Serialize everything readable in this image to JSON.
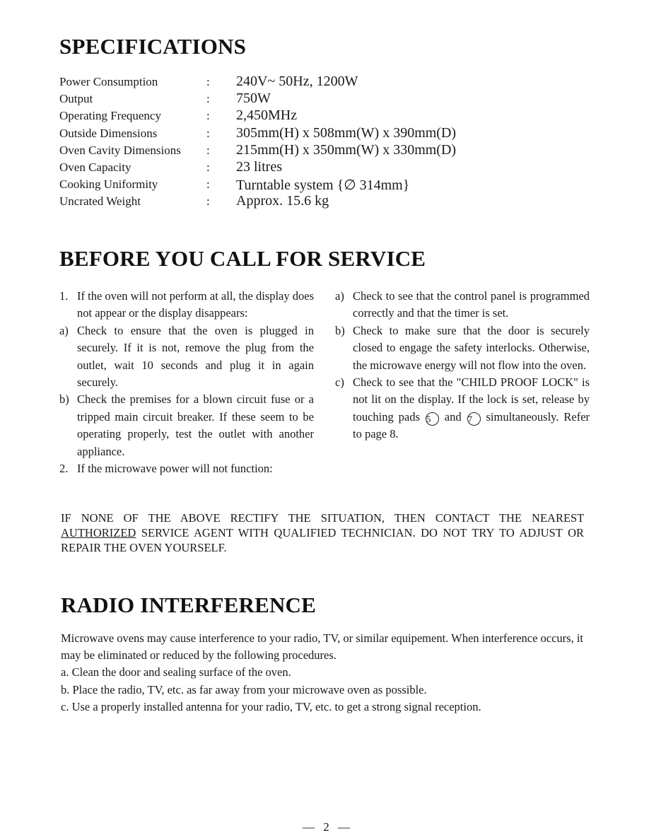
{
  "specifications": {
    "title": "SPECIFICATIONS",
    "rows": [
      {
        "label": "Power Consumption",
        "sep": ":",
        "value": "240V~ 50Hz, 1200W"
      },
      {
        "label": "Output",
        "sep": ":",
        "value": "750W"
      },
      {
        "label": "Operating Frequency",
        "sep": ":",
        "value": "2,450MHz"
      },
      {
        "label": "Outside Dimensions",
        "sep": ":",
        "value": "305mm(H) x 508mm(W) x 390mm(D)"
      },
      {
        "label": "Oven Cavity Dimensions",
        "sep": ":",
        "value": "215mm(H) x 350mm(W) x 330mm(D)"
      },
      {
        "label": "Oven Capacity",
        "sep": ":",
        "value": "23 litres"
      },
      {
        "label": "Cooking Uniformity",
        "sep": ":",
        "value": "Turntable system {∅ 314mm}"
      },
      {
        "label": "Uncrated Weight",
        "sep": ":",
        "value": "Approx. 15.6 kg"
      }
    ]
  },
  "service": {
    "title": "BEFORE YOU CALL FOR SERVICE",
    "left": [
      {
        "marker": "1.",
        "text": "If the oven will not perform at all, the display does not appear or the display disappears:"
      },
      {
        "marker": "a)",
        "text": "Check to ensure that the oven is plugged in securely. If it is not, remove the plug from the outlet, wait 10 seconds and plug it in again securely."
      },
      {
        "marker": "b)",
        "text": "Check the premises for a blown circuit fuse or a tripped main circuit breaker. If these seem to be operating properly, test the outlet with another appliance."
      },
      {
        "marker": "2.",
        "text": "If the microwave power will not function:"
      }
    ],
    "right": [
      {
        "marker": "a)",
        "text": "Check to see that the control panel is programmed correctly and that the timer is set."
      },
      {
        "marker": "b)",
        "text": "Check to make sure that the door is securely closed to engage the safety interlocks. Otherwise, the microwave energy will not flow into the oven."
      },
      {
        "marker": "c)",
        "text_before": "Check to see that the \"CHILD PROOF LOCK\" is not lit on the display. If the lock is set, release by touching pads",
        "pad1": "5",
        "text_mid": "and",
        "pad2": "7",
        "text_after": "simultaneously. Refer to page 8."
      }
    ],
    "notice": {
      "before": "IF NONE OF THE ABOVE RECTIFY THE SITUATION, THEN CONTACT THE NEAREST",
      "underlined": "AUTHORIZED",
      "after": "SERVICE AGENT WITH QUALIFIED TECHNICIAN. DO NOT TRY TO ADJUST OR REPAIR THE OVEN YOURSELF."
    }
  },
  "radio": {
    "title": "RADIO INTERFERENCE",
    "intro": "Microwave ovens may cause interference to your radio, TV, or similar equipement. When interference occurs, it may be eliminated or reduced by the following procedures.",
    "steps": [
      "a. Clean the door and sealing surface of the oven.",
      "b. Place the radio, TV, etc. as far away from your microwave oven as possible.",
      "c. Use a properly installed antenna for your radio, TV, etc. to get a strong signal reception."
    ]
  },
  "footer": {
    "page_number": "— 2 —"
  }
}
